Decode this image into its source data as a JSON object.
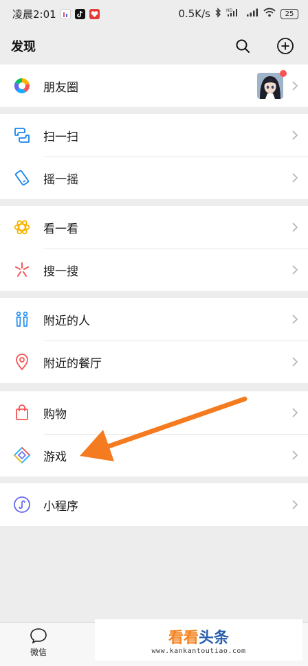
{
  "status_bar": {
    "time": "凌晨2:01",
    "net_speed": "0.5K/s",
    "battery": "25"
  },
  "nav": {
    "title": "发现"
  },
  "groups": [
    {
      "items": [
        {
          "label": "朋友圈",
          "icon": "moments-icon",
          "has_avatar": true,
          "badge": "red-dot"
        }
      ]
    },
    {
      "items": [
        {
          "label": "扫一扫",
          "icon": "scan-icon"
        },
        {
          "label": "摇一摇",
          "icon": "shake-icon"
        }
      ]
    },
    {
      "items": [
        {
          "label": "看一看",
          "icon": "top-stories-icon"
        },
        {
          "label": "搜一搜",
          "icon": "search-feature-icon"
        }
      ]
    },
    {
      "items": [
        {
          "label": "附近的人",
          "icon": "people-nearby-icon"
        },
        {
          "label": "附近的餐厅",
          "icon": "restaurant-pin-icon"
        }
      ]
    },
    {
      "items": [
        {
          "label": "购物",
          "icon": "shopping-bag-icon"
        },
        {
          "label": "游戏",
          "icon": "games-icon"
        }
      ]
    },
    {
      "items": [
        {
          "label": "小程序",
          "icon": "mini-programs-icon"
        }
      ]
    }
  ],
  "tab_bar": {
    "chats_label": "微信"
  },
  "watermark": {
    "brand_part1": "看看",
    "brand_part2": "头条",
    "url": "www.kankantoutiao.com"
  },
  "annotation": {
    "arrow_color": "#f47b20",
    "target": "游戏"
  },
  "colors": {
    "background": "#ededed",
    "cell": "#ffffff",
    "badge": "#fa5151",
    "wechat_green": "#07c160"
  }
}
